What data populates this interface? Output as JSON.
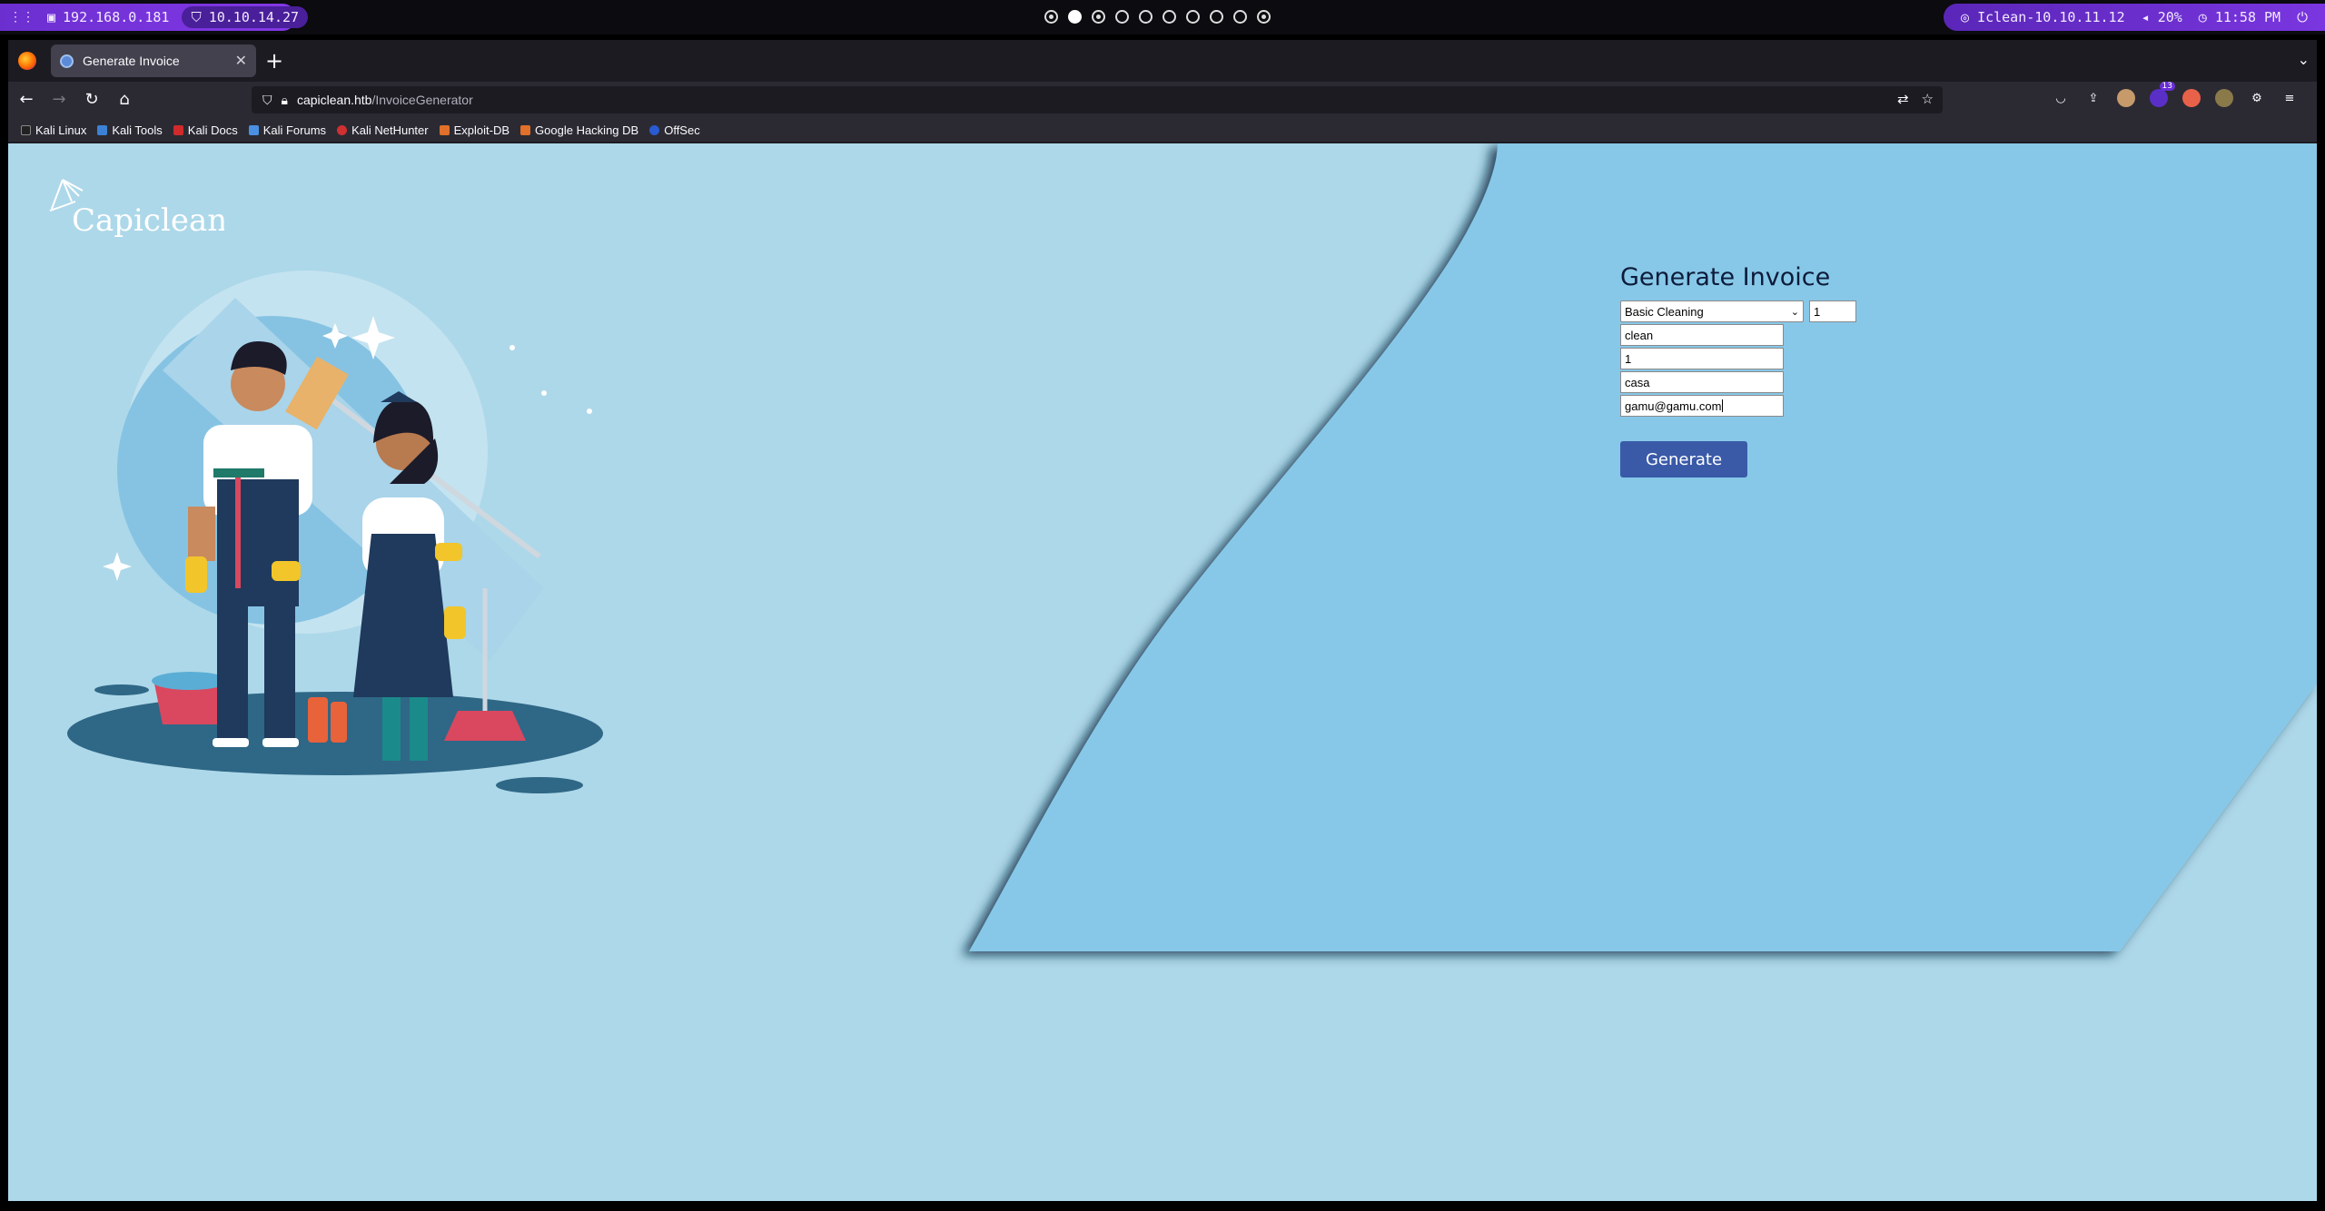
{
  "system_bar": {
    "left_items": [
      "192.168.0.181",
      "10.10.14.27"
    ],
    "workspaces": 10,
    "active_workspace": 2,
    "right_items": [
      "Iclean-10.10.11.12",
      "20%",
      "11:58 PM"
    ]
  },
  "browser": {
    "tab_title": "Generate Invoice",
    "url_host": "capiclean.htb",
    "url_path": "/InvoiceGenerator",
    "extension_badge": "13",
    "bookmarks": [
      "Kali Linux",
      "Kali Tools",
      "Kali Docs",
      "Kali Forums",
      "Kali NetHunter",
      "Exploit-DB",
      "Google Hacking DB",
      "OffSec"
    ]
  },
  "page": {
    "logo_text": "Capiclean",
    "form": {
      "title": "Generate Invoice",
      "service_selected": "Basic Cleaning",
      "quantity": "1",
      "fields": [
        "clean",
        "1",
        "casa",
        "gamu@gamu.com"
      ],
      "submit_label": "Generate"
    }
  },
  "colors": {
    "page_bg": "#add8e9",
    "panel_bg": "#87c8e8",
    "button": "#3a5aa8",
    "accent_purple": "#7a36e0"
  }
}
